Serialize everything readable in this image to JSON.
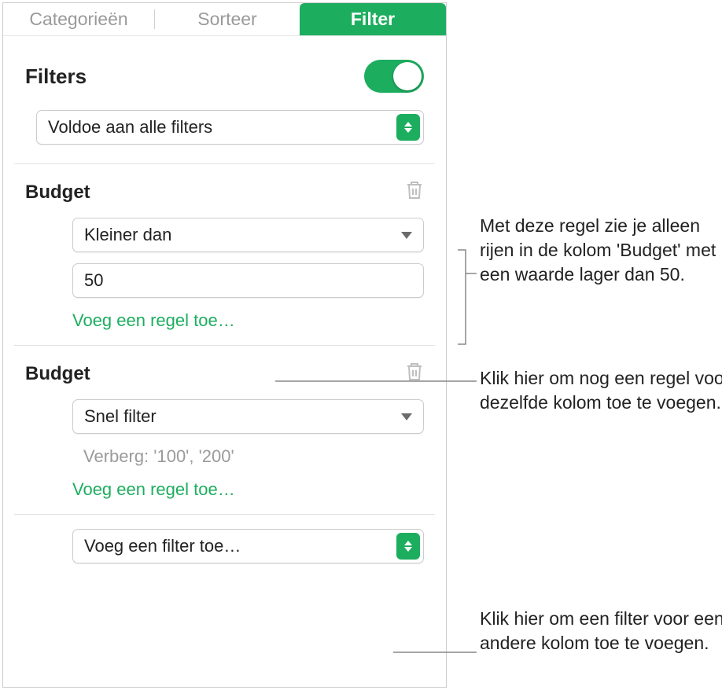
{
  "tabs": {
    "categories": "Categorieën",
    "sort": "Sorteer",
    "filter": "Filter"
  },
  "filters": {
    "title": "Filters",
    "toggle_on": true,
    "match_label": "Voldoe aan alle filters"
  },
  "groups": [
    {
      "column": "Budget",
      "rule_type": "Kleiner dan",
      "value": "50",
      "add_rule": "Voeg een regel toe…"
    },
    {
      "column": "Budget",
      "rule_type": "Snel filter",
      "hide_text": "Verberg: '100', '200'",
      "add_rule": "Voeg een regel toe…"
    }
  ],
  "add_filter": "Voeg een filter toe…",
  "callouts": {
    "rule50": "Met deze regel zie je alleen rijen in de kolom 'Budget' met een waarde lager dan 50.",
    "addrule": "Klik hier om nog een regel voor dezelfde kolom toe te voegen.",
    "addfilter": "Klik hier om een filter voor een andere kolom toe te voegen."
  }
}
